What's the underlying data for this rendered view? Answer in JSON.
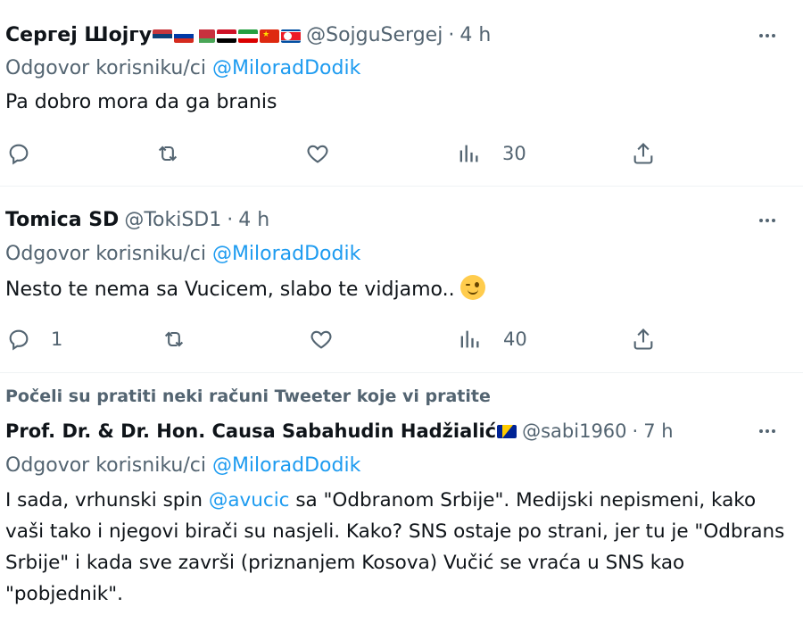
{
  "tweets": [
    {
      "name": "Сергеј Шојгу",
      "flags": [
        "serbia",
        "russia",
        "belarus",
        "syria",
        "iran",
        "china",
        "north-korea"
      ],
      "handle": "@SojguSergej",
      "dot": "·",
      "time": "4 h",
      "reply_prefix": "Odgovor korisniku/ci ",
      "reply_mention": "@MiloradDodik",
      "text": "Pa dobro mora da ga branis",
      "replies": "",
      "views": "30"
    },
    {
      "name": "Tomica SD",
      "handle": "@TokiSD1",
      "dot": "·",
      "time": "4 h",
      "reply_prefix": "Odgovor korisniku/ci ",
      "reply_mention": "@MiloradDodik",
      "text": "Nesto te nema sa Vucicem, slabo te vidjamo..",
      "emoji": "winking-face",
      "replies": "1",
      "views": "40"
    },
    {
      "social_context": "Počeli su pratiti neki računi Tweeter koje vi pratite",
      "name": "Prof. Dr. & Dr. Hon. Causa Sabahudin Hadžialić",
      "flags": [
        "bosnia"
      ],
      "handle": "@sabi1960",
      "dot": "·",
      "time": "7 h",
      "reply_prefix": "Odgovor korisniku/ci ",
      "reply_mention": "@MiloradDodik",
      "text_before": "I sada, vrhunski spin ",
      "text_mention": "@avucic",
      "text_after": " sa \"Odbranom Srbije\". Medijski nepismeni, kako vaši tako i njegovi birači su nasjeli. Kako? SNS ostaje po strani, jer tu je \"Odbrans Srbije\" i kada sve završi (priznanjem Kosova) Vučić se vraća u SNS kao \"pobjednik\"."
    }
  ],
  "colors": {
    "link": "#1d9bf0",
    "muted": "#536471",
    "text": "#0f1419",
    "divider": "#eff3f4"
  },
  "icons": [
    "reply-icon",
    "retweet-icon",
    "like-icon",
    "views-icon",
    "share-icon",
    "more-icon"
  ]
}
